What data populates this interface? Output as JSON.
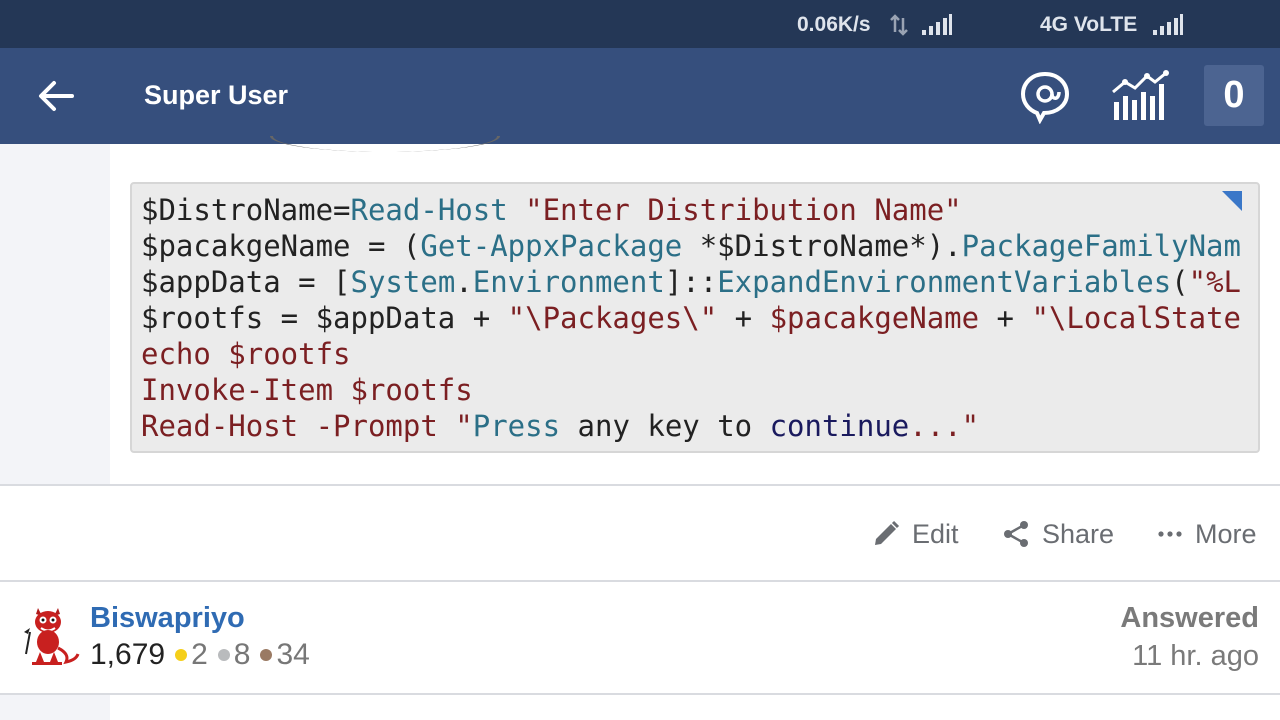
{
  "status_bar": {
    "speed": "0.06K/s",
    "network": "4G VoLTE",
    "icons": [
      "data-transfer-icon",
      "signal-icon",
      "signal-icon"
    ]
  },
  "app_bar": {
    "title": "Super User",
    "back_icon": "arrow-left-icon",
    "inbox_icon": "inbox-icon",
    "achievements_icon": "reputation-chart-icon",
    "notification_count": "0"
  },
  "code_block": {
    "lines": [
      [
        [
          "plain",
          "$DistroName="
        ],
        [
          "cmd",
          "Read-Host"
        ],
        [
          "plain",
          " "
        ],
        [
          "str",
          "\"Enter Distribution Name\""
        ]
      ],
      [
        [
          "plain",
          "$pacakgeName = ("
        ],
        [
          "cmd",
          "Get-AppxPackage"
        ],
        [
          "plain",
          " *$DistroName*)."
        ],
        [
          "cmd",
          "PackageFamilyNam"
        ]
      ],
      [
        [
          "plain",
          "$appData = ["
        ],
        [
          "cmd",
          "System"
        ],
        [
          "plain",
          "."
        ],
        [
          "cmd",
          "Environment"
        ],
        [
          "plain",
          "]::"
        ],
        [
          "cmd",
          "ExpandEnvironmentVariables"
        ],
        [
          "plain",
          "("
        ],
        [
          "str",
          "\"%L"
        ]
      ],
      [
        [
          "plain",
          "$rootfs = $appData + "
        ],
        [
          "str",
          "\"\\Packages\\\""
        ],
        [
          "plain",
          " + "
        ],
        [
          "kw",
          "$pacakgeName"
        ],
        [
          "plain",
          " + "
        ],
        [
          "str",
          "\"\\LocalState"
        ]
      ],
      [
        [
          "kw",
          "echo $rootfs"
        ]
      ],
      [
        [
          "kw",
          "Invoke-Item $rootfs"
        ]
      ],
      [
        [
          "kw",
          "Read-Host -Prompt "
        ],
        [
          "str",
          "\""
        ],
        [
          "cmd",
          "Press"
        ],
        [
          "plain",
          " any key to "
        ],
        [
          "navy",
          "continue"
        ],
        [
          "str",
          "...\""
        ]
      ]
    ]
  },
  "actions": {
    "edit": "Edit",
    "share": "Share",
    "more": "More"
  },
  "answer": {
    "user_name": "Biswapriyo",
    "reputation": "1,679",
    "gold_badges": "2",
    "silver_badges": "8",
    "bronze_badges": "34",
    "status": "Answered",
    "time": "11 hr. ago"
  },
  "colors": {
    "status_bar": "#243756",
    "app_bar": "#364f7d",
    "badge_bg": "#4c6491",
    "link": "#2f6bb3",
    "gold": "#f5cf1a",
    "silver": "#b9bbbd",
    "bronze": "#9a7a63"
  }
}
